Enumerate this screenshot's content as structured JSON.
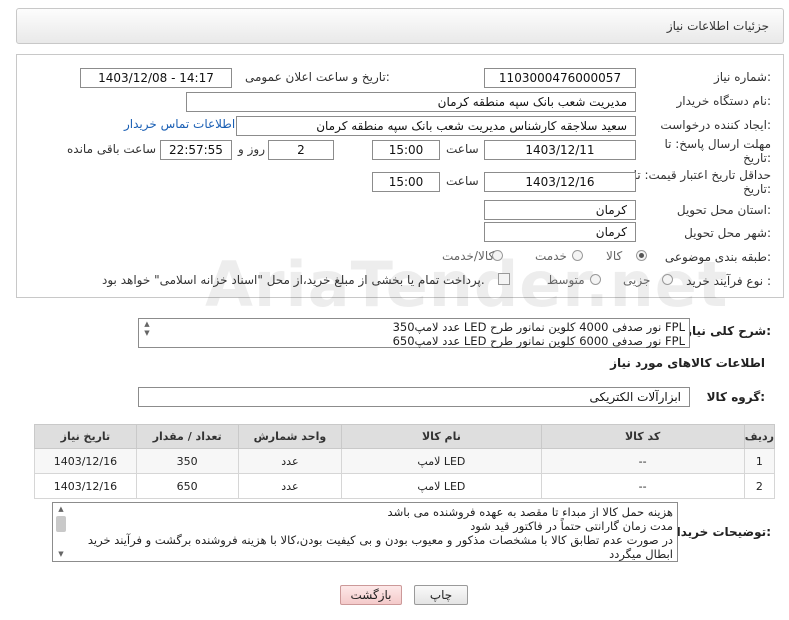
{
  "page_title": "جزئیات اطلاعات نیاز",
  "watermark_text": "AriaTender.net",
  "form": {
    "need_number_label": "شماره نیاز:",
    "need_number": "1103000476000057",
    "announce_label": "تاریخ و ساعت اعلان عمومی:",
    "announce_value": "1403/12/08 - 14:17",
    "buyer_org_label": "نام دستگاه خریدار:",
    "buyer_org": "مدیریت شعب بانک سپه منطقه کرمان",
    "requester_label": "ایجاد کننده درخواست:",
    "requester": "سعید سلاجقه کارشناس مدیریت شعب بانک سپه منطقه کرمان",
    "contact_link": "اطلاعات تماس خریدار",
    "reply_deadline_label": "مهلت ارسال پاسخ: تا تاریخ:",
    "reply_date": "1403/12/11",
    "time_label": "ساعت",
    "reply_time": "15:00",
    "days_value": "2",
    "days_label": "روز و",
    "remaining_time": "22:57:55",
    "remaining_label": "ساعت باقی مانده",
    "price_validity_label": "حداقل تاریخ اعتبار قیمت: تا تاریخ:",
    "price_date": "1403/12/16",
    "price_time": "15:00",
    "province_label": "استان محل تحویل:",
    "province": "کرمان",
    "city_label": "شهر محل تحویل:",
    "city": "کرمان",
    "category_label": "طبقه بندی موضوعی:",
    "category_options": [
      "کالا",
      "خدمت",
      "کالا/خدمت"
    ],
    "process_label": "نوع فرآیند خرید :",
    "process_options": [
      "جزیی",
      "متوسط"
    ],
    "treasury_note": "پرداخت تمام یا بخشی از مبلغ خرید،از محل \"اسناد خزانه اسلامی\" خواهد بود."
  },
  "summary": {
    "label": "شرح کلی نیاز:",
    "line1": "350عدد لامپ LED نور صدفی 4000 کلوین نمانور طرح FPL",
    "line2": "650عدد لامپ LED نور صدفی 6000 کلوین نمانور طرح FPL"
  },
  "goods_section_title": "اطلاعات کالاهای مورد نیاز",
  "goods_group_label": "گروه کالا:",
  "goods_group": "ابزارآلات الکتریکی",
  "table": {
    "headers": [
      "ردیف",
      "کد کالا",
      "نام کالا",
      "واحد شمارش",
      "تعداد / مقدار",
      "تاریخ نیاز"
    ],
    "rows": [
      [
        "1",
        "--",
        "لامپ LED",
        "عدد",
        "350",
        "1403/12/16"
      ],
      [
        "2",
        "--",
        "لامپ LED",
        "عدد",
        "650",
        "1403/12/16"
      ]
    ]
  },
  "buyer_notes": {
    "label": "توضیحات خریدار:",
    "lines": [
      "هزینه حمل کالا از مبداء تا مقصد به عهده فروشنده می باشد",
      "مدت زمان گارانتی حتماً در فاکتور قید شود",
      "در صورت عدم تطابق کالا با مشخصات مذکور و معیوب بودن و بی کیفیت بودن،کالا با هزینه فروشنده برگشت و فرآیند خرید ابطال میگردد"
    ]
  },
  "buttons": {
    "print": "چاپ",
    "back": "بازگشت"
  }
}
